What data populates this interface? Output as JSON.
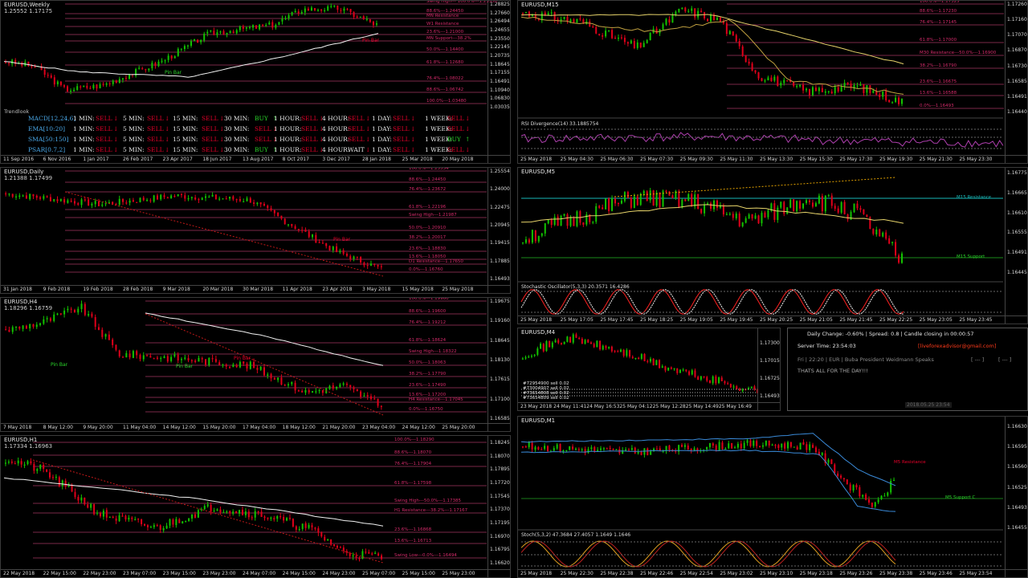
{
  "colors": {
    "bull": "#12c400",
    "bear": "#e0001a",
    "ma_white": "#f2f2f2",
    "ma_yellow": "#e6d36a",
    "fib": "#7a2848",
    "fib_text": "#d42a6a",
    "green_text": "#2bd62b",
    "red_text": "#e8002a"
  },
  "weekly": {
    "title": "EURUSD,Weekly",
    "price": "1.25552 1.17175",
    "yticks": [
      "1.28825",
      "1.27660",
      "1.26494",
      "1.24655",
      "1.23550",
      "1.22145",
      "1.20735",
      "1.18645",
      "1.17155",
      "1.16491",
      "1.10940",
      "1.06830",
      "1.03035"
    ],
    "xticks": [
      "11 Sep 2016",
      "6 Nov 2016",
      "1 Jan 2017",
      "26 Feb 2017",
      "23 Apr 2017",
      "18 Jun 2017",
      "13 Aug 2017",
      "8 Oct 2017",
      "3 Dec 2017",
      "28 Jan 2018",
      "25 Mar 2018",
      "20 May 2018"
    ],
    "levels": [
      "Swing High--- 100.0%---1.25550",
      "88.6%---1.24450",
      "MN Resistance",
      "W1 Resistance",
      "23.6%---1.21000",
      "MN Support---38.2%",
      "50.0%---1.14400",
      "61.8%---1.12680",
      "76.4%---1.08022",
      "88.6%---1.06742",
      "100.0%---1.03480"
    ],
    "labels": [
      "Pin Bar",
      "Pin Bar"
    ],
    "trendlook": {
      "title": "Trendlook",
      "rows": [
        {
          "name": "MACD[12,24,6]",
          "cols": [
            "1 MIN:",
            "SELL",
            "5 MIN:",
            "SELL",
            "15 MIN:",
            "SELL",
            "30 MIN:",
            "BUY",
            "1 HOUR:",
            "SELL",
            "4 HOUR:",
            "SELL",
            "1 DAY:",
            "SELL",
            "1 WEEK:",
            "SELL"
          ]
        },
        {
          "name": "EMA[10:20]",
          "cols": [
            "1 MIN:",
            "SELL",
            "5 MIN:",
            "SELL",
            "15 MIN:",
            "SELL",
            "30 MIN:",
            "SELL",
            "1 HOUR:",
            "SELL",
            "4 HOUR:",
            "SELL",
            "1 DAY:",
            "SELL",
            "1 WEEK:",
            "SELL"
          ]
        },
        {
          "name": "SMA[50:150]",
          "cols": [
            "1 MIN:",
            "SELL",
            "5 MIN:",
            "SELL",
            "15 MIN:",
            "SELL",
            "30 MIN:",
            "SELL",
            "1 HOUR:",
            "SELL",
            "4 HOUR:",
            "SELL",
            "1 DAY:",
            "SELL",
            "1 WEEK:",
            "BUY"
          ]
        },
        {
          "name": "PSAR[0.7,2]",
          "cols": [
            "1 MIN:",
            "SELL",
            "5 MIN:",
            "SELL",
            "15 MIN:",
            "SELL",
            "30 MIN:",
            "BUY",
            "1 HOUR:",
            "SELL",
            "4 HOUR:",
            "WAIT",
            "1 DAY:",
            "SELL",
            "1 WEEK:",
            "SELL"
          ]
        }
      ]
    }
  },
  "daily": {
    "title": "EURUSD,Daily",
    "price": "1.21388 1.17499",
    "yticks": [
      "1.25554",
      "1.24000",
      "1.22475",
      "1.20945",
      "1.19415",
      "1.17885",
      "1.16493"
    ],
    "xticks": [
      "31 Jan 2018",
      "9 Feb 2018",
      "19 Feb 2018",
      "28 Feb 2018",
      "9 Mar 2018",
      "20 Mar 2018",
      "30 Mar 2018",
      "11 Apr 2018",
      "23 Apr 2018",
      "3 May 2018",
      "15 May 2018",
      "25 May 2018"
    ],
    "levels": [
      "100.0%---1.25554",
      "88.6%---1.24450",
      "76.4%---1.23672",
      "61.8%---1.22196",
      "Swing High---1.21987",
      "50.0%---1.20910",
      "38.2%---1.20017",
      "23.6%---1.18830",
      "13.6%---1.18050",
      "D1 Resistance---1.17650",
      "0.0%---1.16760"
    ],
    "labels": [
      "Pin Bar"
    ]
  },
  "h4": {
    "title": "EURUSD,H4",
    "price": "1.18296 1.16759",
    "yticks": [
      "1.19675",
      "1.19160",
      "1.18645",
      "1.18130",
      "1.17615",
      "1.17100",
      "1.16585"
    ],
    "xticks": [
      "7 May 2018",
      "8 May 12:00",
      "9 May 20:00",
      "11 May 04:00",
      "14 May 12:00",
      "15 May 20:00",
      "17 May 04:00",
      "18 May 12:00",
      "21 May 20:00",
      "23 May 04:00",
      "24 May 12:00",
      "25 May 20:00"
    ],
    "levels": [
      "100.0%---1.19960",
      "88.6%---1.19600",
      "76.4%---1.19212",
      "61.8%---1.18624",
      "Swing High---1.18322",
      "50.0%---1.18063",
      "38.2%---1.17790",
      "23.6%---1.17490",
      "13.6%---1.17200",
      "H4 Resistance---1.17045",
      "0.0%---1.16750"
    ],
    "labels": [
      "Pin Bar",
      "Pin Bar",
      "Pin Bar"
    ]
  },
  "h1": {
    "title": "EURUSD,H1",
    "price": "1.17334 1.16963",
    "yticks": [
      "1.18245",
      "1.18070",
      "1.17895",
      "1.17720",
      "1.17545",
      "1.17370",
      "1.17195",
      "1.16970",
      "1.16795",
      "1.16620"
    ],
    "xticks": [
      "22 May 2018",
      "22 May 15:00",
      "22 May 23:00",
      "23 May 07:00",
      "23 May 15:00",
      "23 May 23:00",
      "24 May 07:00",
      "24 May 15:00",
      "24 May 23:00",
      "25 May 07:00",
      "25 May 15:00",
      "25 May 23:00"
    ],
    "levels": [
      "100.0%---1.18290",
      "88.6%---1.18070",
      "76.4%---1.17904",
      "61.8%---1.17598",
      "Swing High---50.0%---1.17385",
      "H1 Resistance---38.2%---1.17167",
      "23.6%---1.16868",
      "13.6%---1.16713",
      "Swing Low---0.0%---1.16494"
    ]
  },
  "m15": {
    "title": "EURUSD,M15",
    "yticks": [
      "1.17260",
      "1.17160",
      "1.17070",
      "1.16870",
      "1.16730",
      "1.16585",
      "1.16491",
      "1.16440"
    ],
    "xticks": [
      "25 May 2018",
      "25 May 04:30",
      "25 May 06:30",
      "25 May 07:30",
      "25 May 09:30",
      "25 May 11:30",
      "25 May 13:30",
      "25 May 15:30",
      "25 May 17:30",
      "25 May 19:30",
      "25 May 21:30",
      "25 May 23:30"
    ],
    "levels": [
      "100.0%---1.17325",
      "88.6%---1.17230",
      "76.4%---1.17145",
      "61.8%---1.17000",
      "M30 Resistance---50.0%---1.16900",
      "38.2%---1.16790",
      "23.6%---1.16675",
      "13.6%---1.16588",
      "0.0%---1.16493"
    ],
    "indicator": {
      "title": "RSI Divergence(14) 33.1885754",
      "ticks": [
        "100",
        "70",
        "50",
        "30",
        "0"
      ]
    }
  },
  "m5": {
    "title": "EURUSD,M5",
    "yticks": [
      "1.16775",
      "1.16665",
      "1.16610",
      "1.16555",
      "1.16491",
      "1.16445"
    ],
    "xticks": [
      "25 May 2018",
      "25 May 17:05",
      "25 May 17:45",
      "25 May 18:25",
      "25 May 19:05",
      "25 May 19:45",
      "25 May 20:25",
      "25 May 21:05",
      "25 May 21:45",
      "25 May 22:25",
      "25 May 23:05",
      "25 May 23:45"
    ],
    "levels": [
      "M15 Resistance",
      "M15 Support"
    ],
    "indicator": {
      "title": "Stochastic Oscillator(5,3,3) 20.3571 16.4286",
      "ticks": [
        "100",
        "80",
        "20",
        "0"
      ]
    }
  },
  "m1": {
    "title": "EURUSD,M1",
    "yticks": [
      "1.16630",
      "1.16595",
      "1.16560",
      "1.16525",
      "1.16493",
      "1.16455"
    ],
    "xticks": [
      "25 May 2018",
      "25 May 22:30",
      "25 May 22:38",
      "25 May 22:46",
      "25 May 22:54",
      "25 May 23:02",
      "25 May 23:10",
      "25 May 23:18",
      "25 May 23:26",
      "25 May 23:38",
      "25 May 23:46",
      "25 May 23:54"
    ],
    "levels": [
      "M5 Resistance",
      "M5 Support C"
    ],
    "indicator": {
      "title": "Stoch(5,3,2) 47.3684 27.4057 1.1649 1.1646",
      "ticks": [
        "100",
        "80",
        "50",
        "20",
        "0"
      ]
    }
  },
  "m4": {
    "title": "EURUSD,M4",
    "yticks": [
      "1.17300",
      "1.17015",
      "1.16725",
      "1.16493"
    ],
    "xticks": [
      "23 May 2018",
      "24 May 11:41",
      "24 May 16:53",
      "25 May 04:12",
      "25 May 12:28",
      "25 May 14:49",
      "25 May 16:49"
    ],
    "orders": [
      "#72954900 sell 0.02",
      "#73004907 sell 0.02",
      "#73654808 sell 0.02",
      "#73654809 sell 0.02"
    ]
  },
  "info": {
    "header": "Daily Change: -0.60% | Spread: 0.8 | Candle closing in 00:00:57",
    "server_label": "Server Time: 23:54:03",
    "email": "[liveforexadvisor@gmail.com]",
    "news": "Fri | 22:20 | EUR | Buba President Weidmann Speaks",
    "news_end1": "[ --- ]",
    "news_end2": "[ --- ]",
    "message": "THATS ALL FOR THE DAY!!!",
    "stamp": "2018.05.25 23:54"
  }
}
